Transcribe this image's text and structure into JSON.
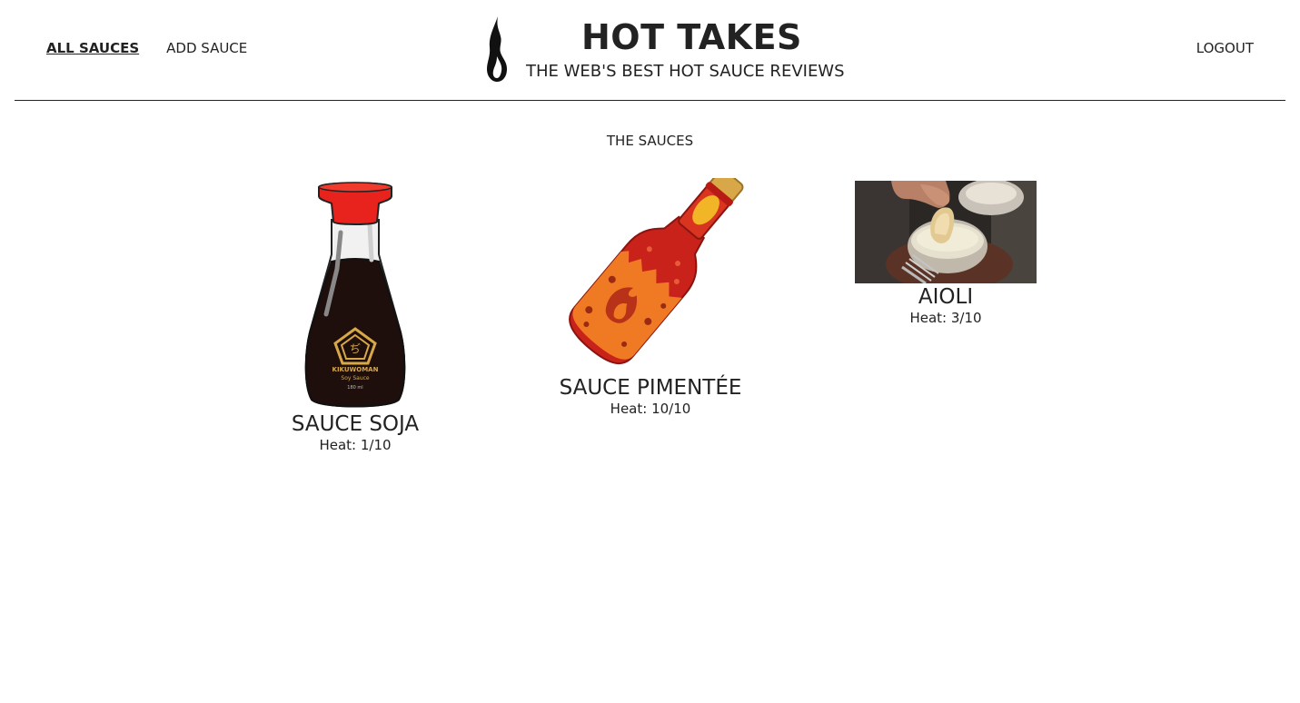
{
  "nav": {
    "all_sauces": "ALL SAUCES",
    "add_sauce": "ADD SAUCE",
    "logout": "LOGOUT"
  },
  "brand": {
    "title": "HOT TAKES",
    "subtitle": "THE WEB'S BEST HOT SAUCE REVIEWS"
  },
  "section_title": "THE SAUCES",
  "sauces": [
    {
      "name": "SAUCE SOJA",
      "heat": "Heat: 1/10",
      "label_brand": "KIKUWOMAN",
      "label_type": "Soy Sauce",
      "label_volume": "180 ml"
    },
    {
      "name": "SAUCE PIMENTÉE",
      "heat": "Heat: 10/10"
    },
    {
      "name": "AIOLI",
      "heat": "Heat: 3/10"
    }
  ],
  "colors": {
    "soy_cap": "#e8221c",
    "soy_liquid": "#1e0f0c",
    "hot_sauce_bottle": "#d9341f",
    "hot_sauce_label": "#f07a24",
    "cork": "#d8a848"
  }
}
